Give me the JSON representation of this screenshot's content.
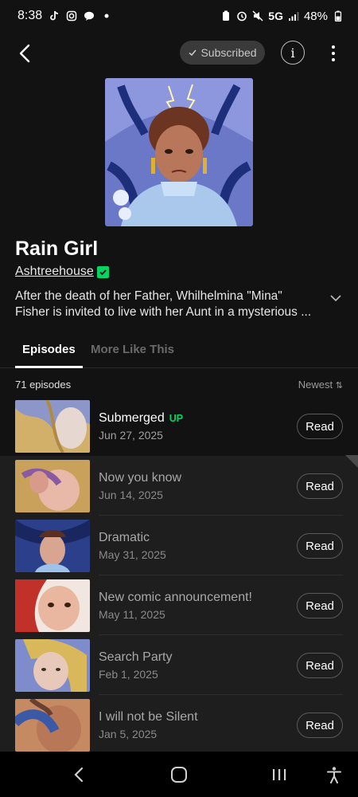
{
  "status_bar": {
    "time": "8:38",
    "network": "5G",
    "battery": "48%"
  },
  "header": {
    "subscribed_label": "Subscribed",
    "info_label": "i"
  },
  "series": {
    "title": "Rain Girl",
    "author": "Ashtreehouse",
    "description": "After the death of her Father, Whilhelmina \"Mina\" Fisher is invited to live with her Aunt in a mysterious ..."
  },
  "tabs": {
    "episodes": "Episodes",
    "more_like_this": "More Like This"
  },
  "list_header": {
    "count": "71 episodes",
    "sort": "Newest"
  },
  "episodes": [
    {
      "title": "Submerged",
      "badge": "UP",
      "date": "Jun 27, 2025",
      "action": "Read"
    },
    {
      "title": "Now you know",
      "date": "Jun 14, 2025",
      "action": "Read"
    },
    {
      "title": "Dramatic",
      "date": "May 31, 2025",
      "action": "Read"
    },
    {
      "title": "New comic announcement!",
      "date": "May 11, 2025",
      "action": "Read"
    },
    {
      "title": "Search Party",
      "date": "Feb 1, 2025",
      "action": "Read"
    },
    {
      "title": "I will not be Silent",
      "date": "Jan 5, 2025",
      "action": "Read"
    }
  ],
  "colors": {
    "accent_green": "#00d564",
    "background": "#121212"
  }
}
